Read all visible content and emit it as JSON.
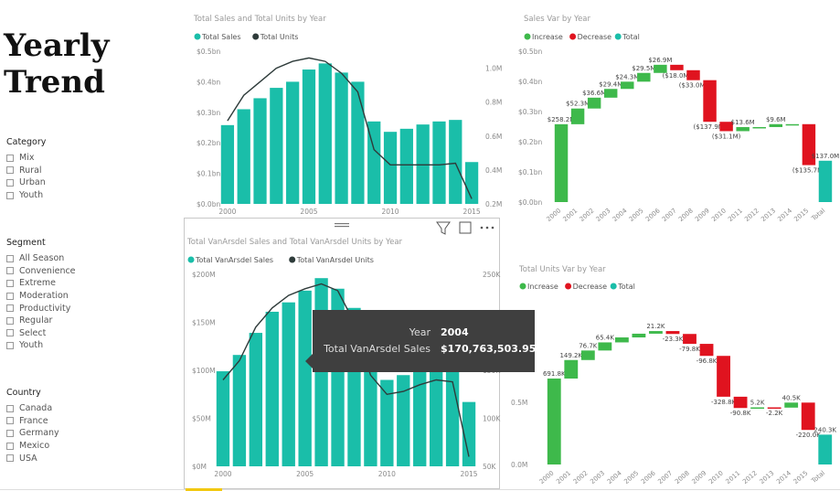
{
  "page": {
    "title": "Yearly\nTrend"
  },
  "slicers": [
    {
      "title": "Category",
      "items": [
        "Mix",
        "Rural",
        "Urban",
        "Youth"
      ]
    },
    {
      "title": "Segment",
      "items": [
        "All Season",
        "Convenience",
        "Extreme",
        "Moderation",
        "Productivity",
        "Regular",
        "Select",
        "Youth"
      ]
    },
    {
      "title": "Country",
      "items": [
        "Canada",
        "France",
        "Germany",
        "Mexico",
        "USA"
      ]
    }
  ],
  "colors": {
    "teal": "#1ABEA9",
    "line": "#2e3b3a",
    "increase": "#3EB94B",
    "decrease": "#E0131F",
    "total": "#1ABEA9",
    "axis": "#8a8a8a"
  },
  "tooltip": {
    "year_label": "Year",
    "year_value": "2004",
    "sales_label": "Total VanArsdel Sales",
    "sales_value": "$170,763,503.95"
  },
  "visual_header": {
    "drag_icon": "drag-handle-icon",
    "filter_icon": "filter-icon",
    "focus_icon": "focus-mode-icon",
    "more_icon": "more-options-icon"
  },
  "chart_data": [
    {
      "type": "bar",
      "title": "Total Sales and Total Units by Year",
      "legend": [
        "Total Sales",
        "Total Units"
      ],
      "legend_position": "top-left",
      "categories": [
        "2000",
        "2001",
        "2002",
        "2003",
        "2004",
        "2005",
        "2006",
        "2007",
        "2008",
        "2009",
        "2010",
        "2011",
        "2012",
        "2013",
        "2014",
        "2015"
      ],
      "x_ticks": [
        "2000",
        "2005",
        "2010",
        "2015"
      ],
      "y_ticks": [
        "$0.0bn",
        "$0.1bn",
        "$0.2bn",
        "$0.3bn",
        "$0.4bn",
        "$0.5bn"
      ],
      "y2_ticks": [
        "0.2M",
        "0.4M",
        "0.6M",
        "0.8M",
        "1.0M"
      ],
      "ylim": [
        0,
        0.5
      ],
      "y2lim": [
        0.2,
        1.1
      ],
      "series": [
        {
          "name": "Total Sales",
          "type": "bar",
          "values": [
            0.258,
            0.31,
            0.346,
            0.38,
            0.4,
            0.44,
            0.46,
            0.43,
            0.4,
            0.27,
            0.236,
            0.246,
            0.26,
            0.27,
            0.275,
            0.137
          ]
        },
        {
          "name": "Total Units",
          "type": "line",
          "values": [
            0.69,
            0.84,
            0.92,
            1.0,
            1.04,
            1.06,
            1.04,
            0.97,
            0.86,
            0.52,
            0.43,
            0.43,
            0.43,
            0.43,
            0.44,
            0.23
          ]
        }
      ]
    },
    {
      "type": "bar",
      "subtype": "waterfall",
      "title": "Sales Var by Year",
      "legend": [
        "Increase",
        "Decrease",
        "Total"
      ],
      "legend_position": "top-left",
      "categories": [
        "2000",
        "2001",
        "2002",
        "2003",
        "2004",
        "2005",
        "2006",
        "2007",
        "2008",
        "2009",
        "2010",
        "2011",
        "2012",
        "2013",
        "2014",
        "2015",
        "Total"
      ],
      "y_ticks": [
        "$0.0bn",
        "$0.1bn",
        "$0.2bn",
        "$0.3bn",
        "$0.4bn",
        "$0.5bn"
      ],
      "ylim": [
        0,
        0.5
      ],
      "values": [
        0.258,
        0.052,
        0.036,
        0.029,
        0.024,
        0.029,
        0.027,
        -0.018,
        -0.033,
        -0.138,
        -0.031,
        0.0136,
        0.0,
        0.0096,
        0.0,
        -0.1357,
        0.137
      ],
      "data_labels": [
        "$258.2M",
        "$52.3M",
        "$36.6M",
        "$29.4M",
        "$24.3M",
        "$29.5M",
        "$26.9M",
        "($18.0M)",
        "($33.0M)",
        "($137.9M)",
        "($31.1M)",
        "$13.6M",
        "",
        "$9.6M",
        "",
        "($135.7M)",
        "$137.0M"
      ]
    },
    {
      "type": "bar",
      "title": "Total VanArsdel Sales and Total VanArsdel Units by Year",
      "legend": [
        "Total VanArsdel Sales",
        "Total VanArsdel Units"
      ],
      "legend_position": "top-left",
      "categories": [
        "2000",
        "2001",
        "2002",
        "2003",
        "2004",
        "2005",
        "2006",
        "2007",
        "2008",
        "2009",
        "2010",
        "2011",
        "2012",
        "2013",
        "2014",
        "2015"
      ],
      "x_ticks": [
        "2000",
        "2005",
        "2010",
        "2015"
      ],
      "y_ticks": [
        "$0M",
        "$50M",
        "$100M",
        "$150M",
        "$200M"
      ],
      "y2_ticks": [
        "50K",
        "100K",
        "150K",
        "200K",
        "250K"
      ],
      "ylim": [
        0,
        200
      ],
      "y2lim": [
        50,
        250
      ],
      "series": [
        {
          "name": "Total VanArsdel Sales",
          "type": "bar",
          "values": [
            99,
            116,
            139,
            161,
            170.76,
            183,
            196,
            185,
            165,
            110,
            90,
            95,
            100,
            108,
            106,
            67
          ]
        },
        {
          "name": "Total VanArsdel Units",
          "type": "line",
          "values": [
            140,
            160,
            195,
            215,
            228,
            235,
            240,
            233,
            200,
            145,
            125,
            128,
            135,
            140,
            138,
            60
          ]
        }
      ]
    },
    {
      "type": "bar",
      "subtype": "waterfall",
      "title": "Total Units Var by Year",
      "legend": [
        "Increase",
        "Decrease",
        "Total"
      ],
      "legend_position": "top-left",
      "categories": [
        "2000",
        "2001",
        "2002",
        "2003",
        "2004",
        "2005",
        "2006",
        "2007",
        "2008",
        "2009",
        "2010",
        "2011",
        "2012",
        "2013",
        "2014",
        "2015",
        "Total"
      ],
      "y_ticks": [
        "0.0M",
        "0.5M"
      ],
      "ylim": [
        0,
        1.2
      ],
      "values": [
        0.6918,
        0.1492,
        0.0767,
        0.0654,
        0.04,
        0.03,
        0.0212,
        -0.0233,
        -0.0798,
        -0.0968,
        -0.3288,
        -0.0908,
        0.0052,
        -0.0022,
        0.0405,
        -0.22,
        0.2403
      ],
      "data_labels": [
        "691.8K",
        "149.2K",
        "76.7K",
        "65.4K",
        "",
        "",
        "21.2K",
        "-23.3K",
        "-79.8K",
        "-96.8K",
        "-328.8K",
        "-90.8K",
        "5.2K",
        "-2.2K",
        "40.5K",
        "-220.0K",
        "240.3K"
      ]
    }
  ]
}
